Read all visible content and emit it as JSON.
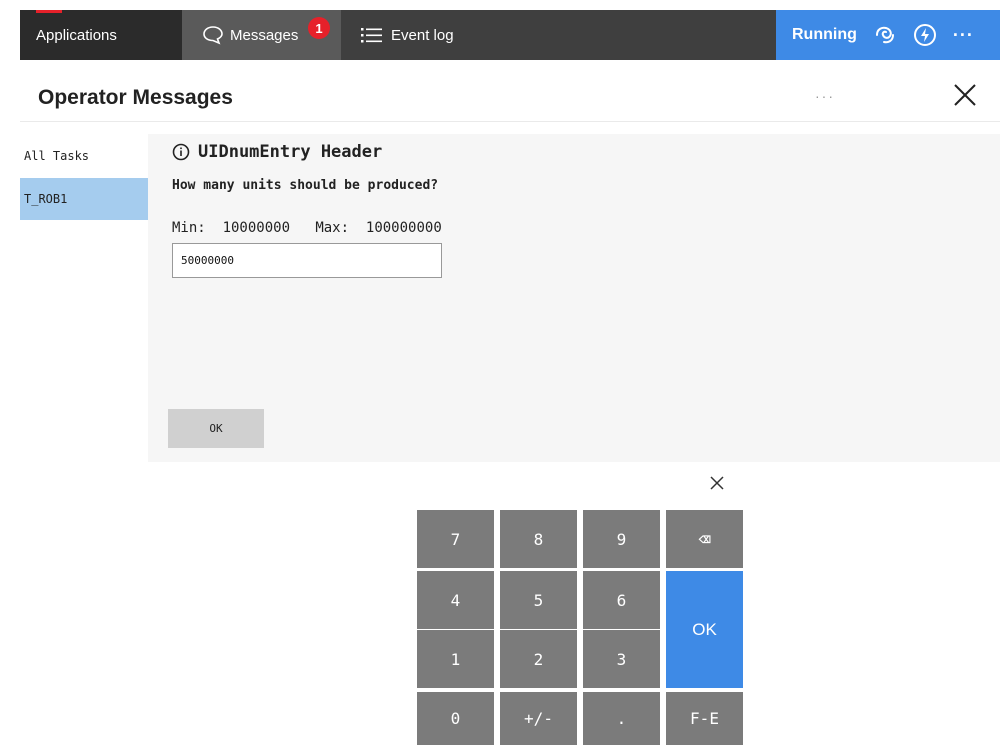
{
  "topbar": {
    "apps_label": "Applications",
    "messages_label": "Messages",
    "messages_badge": "1",
    "eventlog_label": "Event log",
    "status_label": "Running",
    "more_label": "···"
  },
  "header": {
    "title": "Operator Messages",
    "more": "···"
  },
  "sidebar": {
    "items": [
      {
        "label": "All Tasks"
      },
      {
        "label": "T_ROB1"
      }
    ]
  },
  "message": {
    "title": "UIDnumEntry Header",
    "question": "How many units should be produced?",
    "min_label": "Min:",
    "min_value": "10000000",
    "max_label": "Max:",
    "max_value": "100000000",
    "input_value": "50000000",
    "ok_label": "OK"
  },
  "keypad": {
    "keys": [
      "7",
      "8",
      "9",
      "⌫",
      "4",
      "5",
      "6",
      "OK",
      "1",
      "2",
      "3",
      "0",
      "+/-",
      ".",
      "F-E"
    ]
  },
  "colors": {
    "accent": "#3e8ae6",
    "selected": "#a5ccee",
    "badge": "#e6212a",
    "key": "#7b7b7b"
  }
}
